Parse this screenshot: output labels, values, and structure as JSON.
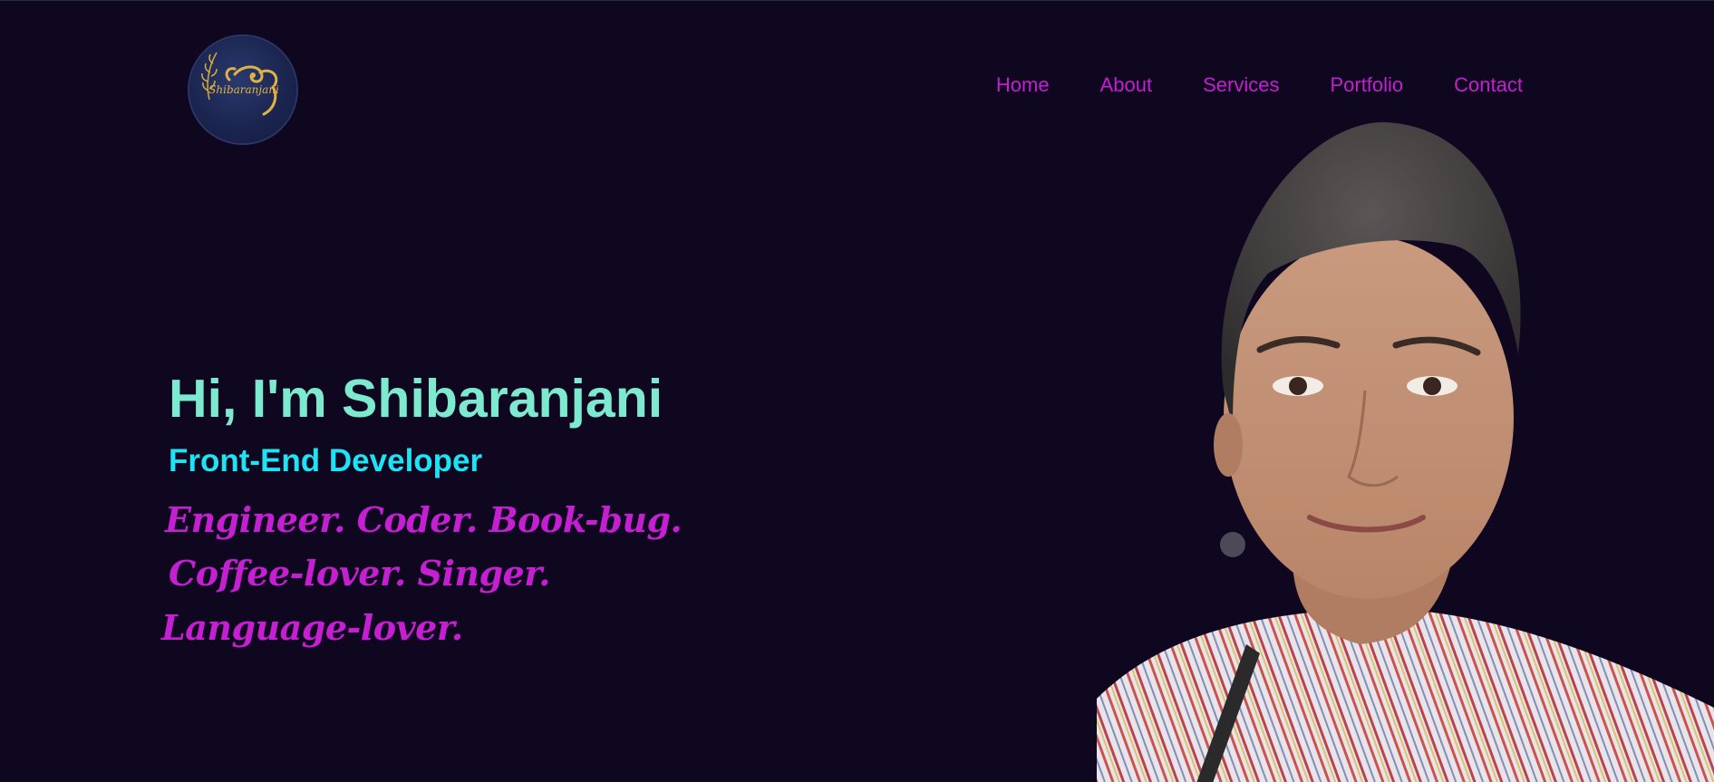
{
  "logo": {
    "text": "Shibaranjani",
    "icon": "ornament-logo-icon",
    "colors": {
      "badge": "#1b2550",
      "gold": "#d9a93a"
    }
  },
  "nav": {
    "items": [
      {
        "label": "Home"
      },
      {
        "label": "About"
      },
      {
        "label": "Services"
      },
      {
        "label": "Portfolio"
      },
      {
        "label": "Contact"
      }
    ]
  },
  "hero": {
    "title": "Hi, I'm Shibaranjani",
    "subtitle": "Front-End Developer",
    "taglines": [
      "Engineer. Coder. Book-bug.",
      "Coffee-lover. Singer.",
      "Language-lover."
    ]
  },
  "portrait": {
    "icon": "profile-photo"
  },
  "colors": {
    "background": "#0f0720",
    "nav": "#c41fd0",
    "title": "#7de9cf",
    "subtitle": "#1de4f4",
    "tagline": "#c41fd0"
  }
}
